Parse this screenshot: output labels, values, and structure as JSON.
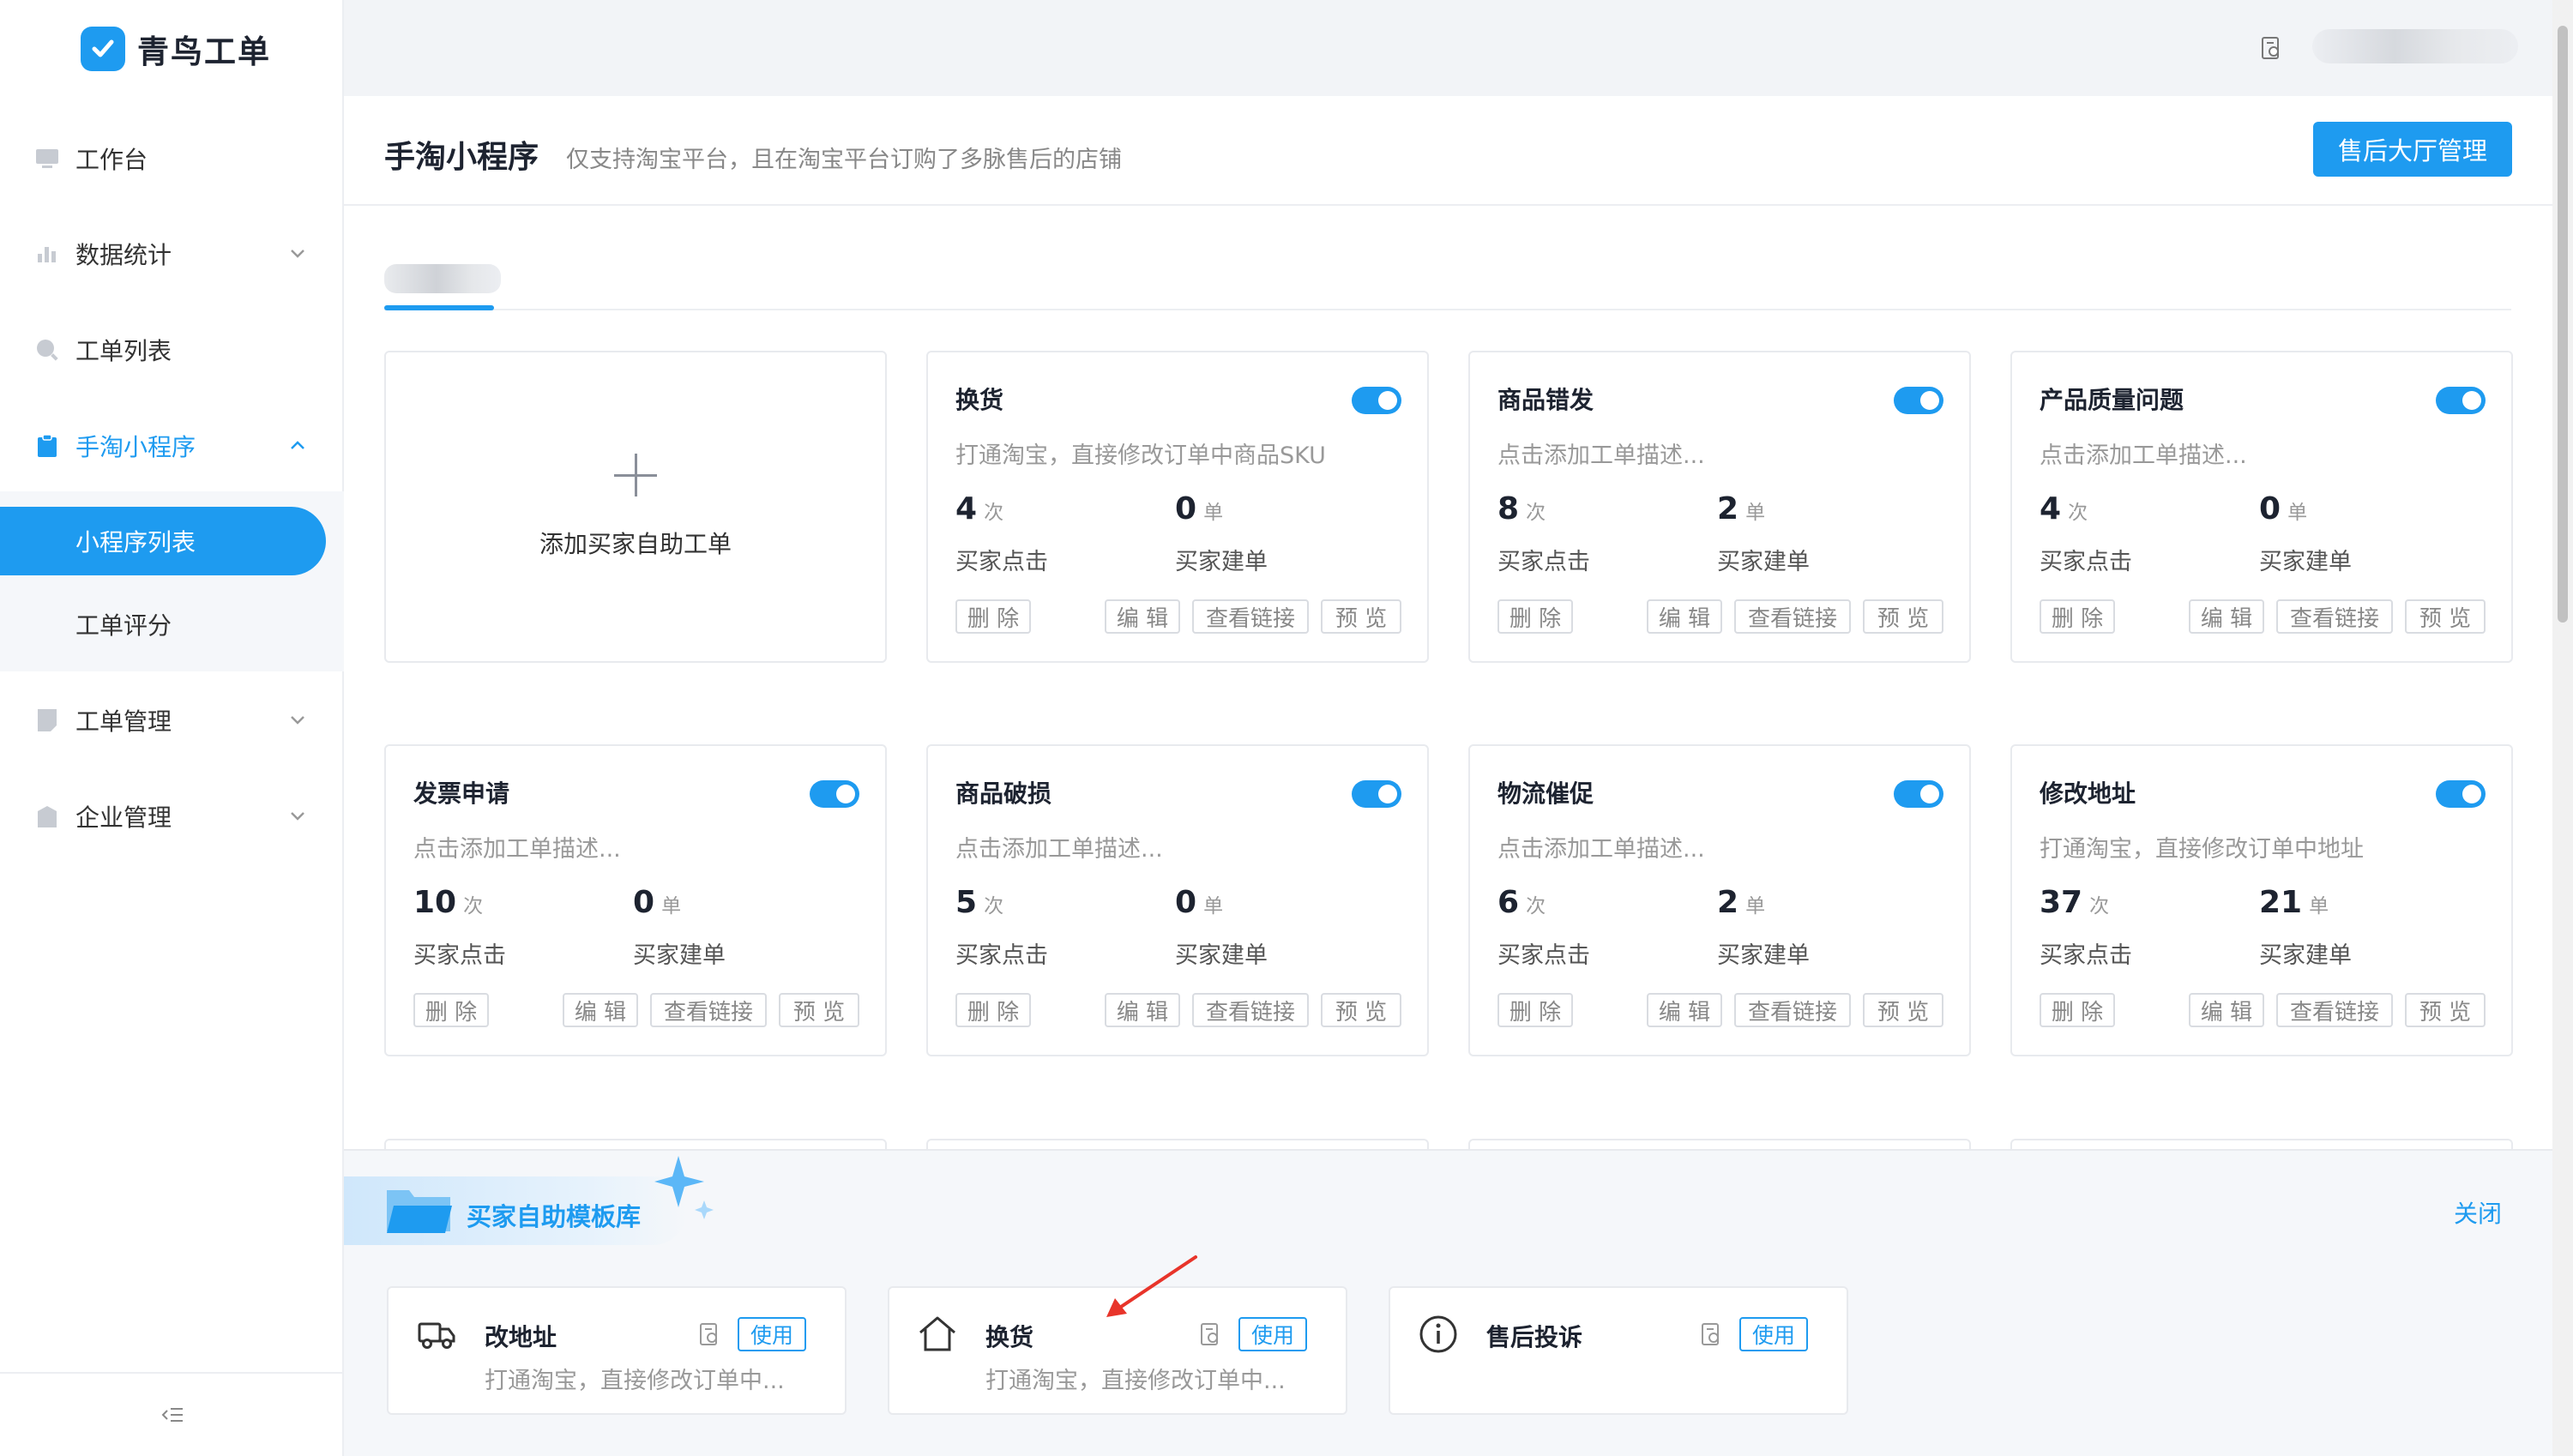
{
  "app": {
    "name": "青鸟工单"
  },
  "sidebar": {
    "items": [
      {
        "label": "工作台",
        "icon": "workbench-icon"
      },
      {
        "label": "数据统计",
        "icon": "bar-chart-icon"
      },
      {
        "label": "工单列表",
        "icon": "search-icon"
      },
      {
        "label": "手淘小程序",
        "icon": "clipboard-icon"
      },
      {
        "label": "工单管理",
        "icon": "document-icon"
      },
      {
        "label": "企业管理",
        "icon": "building-icon"
      }
    ],
    "sub_items": [
      {
        "label": "小程序列表"
      },
      {
        "label": "工单评分"
      }
    ]
  },
  "page": {
    "title": "手淘小程序",
    "description": "仅支持淘宝平台，且在淘宝平台订购了多脉售后的店铺",
    "primary_button": "售后大厅管理"
  },
  "add_card": {
    "label": "添加买家自助工单"
  },
  "cards": [
    {
      "title": "换货",
      "desc": "打通淘宝，直接修改订单中商品SKU",
      "clicks": "4",
      "click_unit": "次",
      "click_label": "买家点击",
      "orders": "0",
      "order_unit": "单",
      "order_label": "买家建单",
      "enabled": true
    },
    {
      "title": "商品错发",
      "desc": "点击添加工单描述...",
      "clicks": "8",
      "click_unit": "次",
      "click_label": "买家点击",
      "orders": "2",
      "order_unit": "单",
      "order_label": "买家建单",
      "enabled": true
    },
    {
      "title": "产品质量问题",
      "desc": "点击添加工单描述...",
      "clicks": "4",
      "click_unit": "次",
      "click_label": "买家点击",
      "orders": "0",
      "order_unit": "单",
      "order_label": "买家建单",
      "enabled": true
    },
    {
      "title": "发票申请",
      "desc": "点击添加工单描述...",
      "clicks": "10",
      "click_unit": "次",
      "click_label": "买家点击",
      "orders": "0",
      "order_unit": "单",
      "order_label": "买家建单",
      "enabled": true
    },
    {
      "title": "商品破损",
      "desc": "点击添加工单描述...",
      "clicks": "5",
      "click_unit": "次",
      "click_label": "买家点击",
      "orders": "0",
      "order_unit": "单",
      "order_label": "买家建单",
      "enabled": true
    },
    {
      "title": "物流催促",
      "desc": "点击添加工单描述...",
      "clicks": "6",
      "click_unit": "次",
      "click_label": "买家点击",
      "orders": "2",
      "order_unit": "单",
      "order_label": "买家建单",
      "enabled": true
    },
    {
      "title": "修改地址",
      "desc": "打通淘宝，直接修改订单中地址",
      "clicks": "37",
      "click_unit": "次",
      "click_label": "买家点击",
      "orders": "21",
      "order_unit": "单",
      "order_label": "买家建单",
      "enabled": true
    }
  ],
  "card_buttons": {
    "delete": "删 除",
    "edit": "编 辑",
    "link": "查看链接",
    "preview": "预 览"
  },
  "library": {
    "title": "买家自助模板库",
    "close": "关闭",
    "templates": [
      {
        "title": "改地址",
        "desc": "打通淘宝，直接修改订单中...",
        "icon": "truck-icon",
        "use": "使用"
      },
      {
        "title": "换货",
        "desc": "打通淘宝，直接修改订单中...",
        "icon": "house-icon",
        "use": "使用"
      },
      {
        "title": "售后投诉",
        "icon": "info-icon",
        "use": "使用"
      }
    ]
  },
  "colors": {
    "accent": "#1e9bf0",
    "annotation": "#e8342a"
  }
}
